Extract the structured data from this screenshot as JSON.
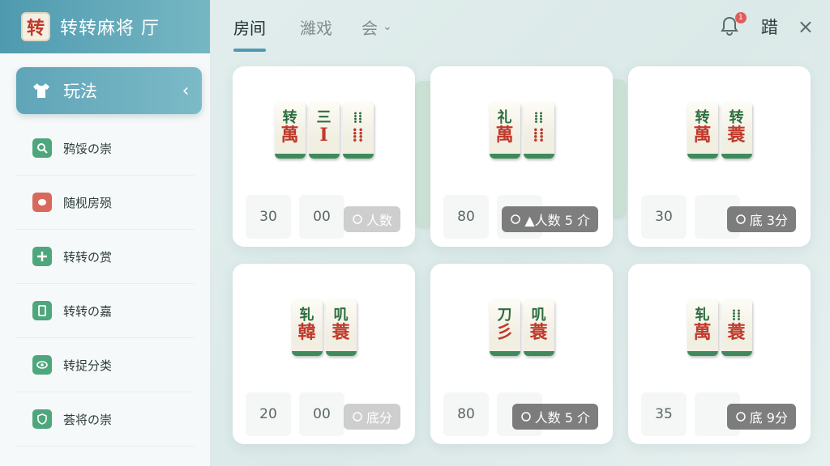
{
  "app": {
    "logo_char": "转",
    "title": "转转麻将 厅"
  },
  "sidebar": {
    "head": {
      "label": "玩法",
      "icon": "shirt-icon"
    },
    "items": [
      {
        "label": "鸦馁の崇",
        "icon": "search-icon",
        "color": "#4ea67d"
      },
      {
        "label": "随枧房殒",
        "icon": "tile-icon",
        "color": "#d9695c"
      },
      {
        "label": "转转の赏",
        "icon": "plus-icon",
        "color": "#4ea67d"
      },
      {
        "label": "转转の嘉",
        "icon": "card-icon",
        "color": "#4ea67d"
      },
      {
        "label": "转捉分类",
        "icon": "eye-icon",
        "color": "#4ea67d"
      },
      {
        "label": "荟将の崇",
        "icon": "shield-icon",
        "color": "#4ea67d"
      }
    ]
  },
  "tabs": [
    {
      "label": "房间",
      "active": true
    },
    {
      "label": "濰戏",
      "active": false
    },
    {
      "label": "会",
      "active": false,
      "dropdown": true
    }
  ],
  "topbar": {
    "notification_count": "1",
    "glyph": "踖",
    "close": "×"
  },
  "cards": [
    {
      "tiles": [
        [
          "转",
          "萬"
        ],
        [
          "三",
          "Ⅰ"
        ],
        [
          "⁞⁞",
          "⁞⁞"
        ]
      ],
      "cells": [
        "30",
        "00"
      ],
      "pill": "人数",
      "pill_style": "light"
    },
    {
      "tiles": [
        [
          "礼",
          "萬"
        ],
        [
          "⁞⁞",
          "⁞⁞"
        ]
      ],
      "cells": [
        "80",
        ""
      ],
      "pill": "▲人数 5 介",
      "pill_style": "dark"
    },
    {
      "tiles": [
        [
          "转",
          "萬"
        ],
        [
          "转",
          "蓑"
        ]
      ],
      "cells": [
        "30",
        ""
      ],
      "pill": "底 3分",
      "pill_style": "dark"
    },
    {
      "tiles": [
        [
          "轧",
          "韓"
        ],
        [
          "叽",
          "蓑"
        ]
      ],
      "cells": [
        "20",
        "00"
      ],
      "pill": "底分",
      "pill_style": "light"
    },
    {
      "tiles": [
        [
          "刀",
          "彡"
        ],
        [
          "叽",
          "蓑"
        ]
      ],
      "cells": [
        "80",
        ""
      ],
      "pill": "人数 5 介",
      "pill_style": "dark"
    },
    {
      "tiles": [
        [
          "轧",
          "萬"
        ],
        [
          "⁞⁞",
          "蓑"
        ]
      ],
      "cells": [
        "35",
        ""
      ],
      "pill": "底 9分",
      "pill_style": "dark"
    }
  ]
}
